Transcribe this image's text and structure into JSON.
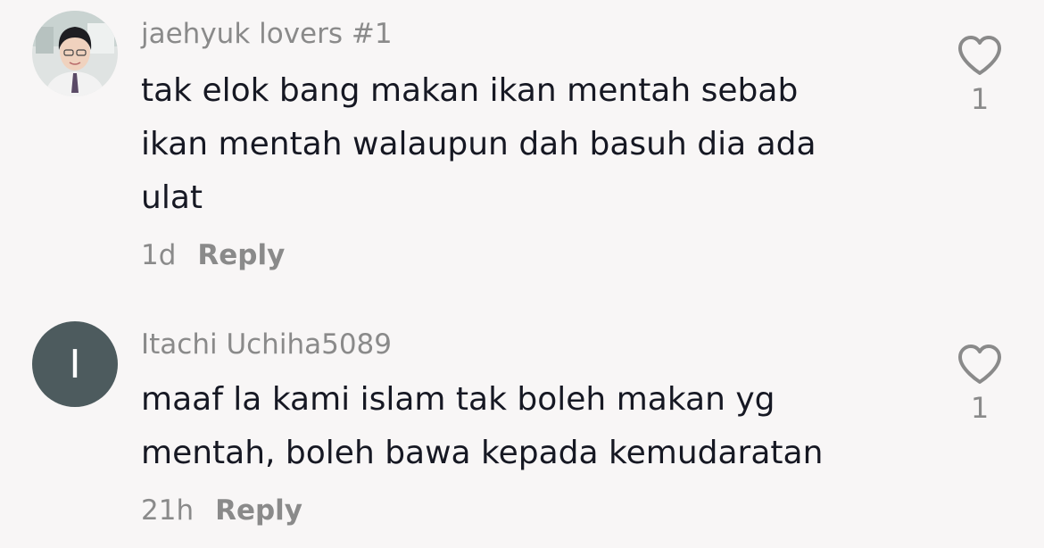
{
  "comments": [
    {
      "username": "jaehyuk lovers #1",
      "avatar_type": "photo",
      "text_lines": [
        "tak elok bang makan ikan mentah sebab",
        "ikan mentah walaupun dah basuh dia ada",
        "ulat"
      ],
      "time": "1d",
      "reply_label": "Reply",
      "like_count": "1",
      "like_icon": "heart-outline-icon"
    },
    {
      "username": "Itachi Uchiha5089",
      "avatar_type": "initial",
      "avatar_initial": "I",
      "avatar_color": "#4d5b5e",
      "text_lines": [
        "maaf la kami islam tak boleh makan yg",
        "mentah, boleh bawa kepada kemudaratan"
      ],
      "time": "21h",
      "reply_label": "Reply",
      "like_count": "1",
      "like_icon": "heart-outline-icon"
    }
  ]
}
